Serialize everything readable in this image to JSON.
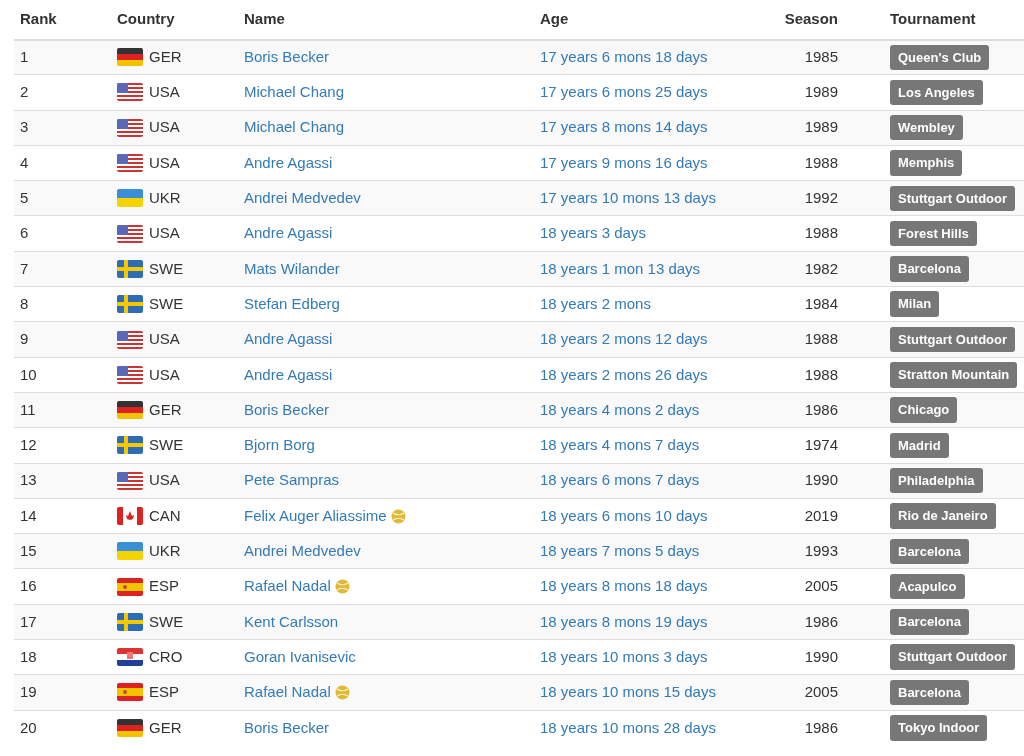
{
  "columns": [
    "Rank",
    "Country",
    "Name",
    "Age",
    "Season",
    "Tournament"
  ],
  "rows": [
    {
      "rank": "1",
      "flag": {
        "kind": "germany"
      },
      "country": "GER",
      "name": "Boris Becker",
      "ball": false,
      "age": "17 years 6 mons 18 days",
      "season": "1985",
      "tournament": "Queen's Club"
    },
    {
      "rank": "2",
      "flag": {
        "kind": "usa"
      },
      "country": "USA",
      "name": "Michael Chang",
      "ball": false,
      "age": "17 years 6 mons 25 days",
      "season": "1989",
      "tournament": "Los Angeles"
    },
    {
      "rank": "3",
      "flag": {
        "kind": "usa"
      },
      "country": "USA",
      "name": "Michael Chang",
      "ball": false,
      "age": "17 years 8 mons 14 days",
      "season": "1989",
      "tournament": "Wembley"
    },
    {
      "rank": "4",
      "flag": {
        "kind": "usa"
      },
      "country": "USA",
      "name": "Andre Agassi",
      "ball": false,
      "age": "17 years 9 mons 16 days",
      "season": "1988",
      "tournament": "Memphis"
    },
    {
      "rank": "5",
      "flag": {
        "kind": "ukraine"
      },
      "country": "UKR",
      "name": "Andrei Medvedev",
      "ball": false,
      "age": "17 years 10 mons 13 days",
      "season": "1992",
      "tournament": "Stuttgart Outdoor"
    },
    {
      "rank": "6",
      "flag": {
        "kind": "usa"
      },
      "country": "USA",
      "name": "Andre Agassi",
      "ball": false,
      "age": "18 years 3 days",
      "season": "1988",
      "tournament": "Forest Hills"
    },
    {
      "rank": "7",
      "flag": {
        "kind": "sweden"
      },
      "country": "SWE",
      "name": "Mats Wilander",
      "ball": false,
      "age": "18 years 1 mon 13 days",
      "season": "1982",
      "tournament": "Barcelona"
    },
    {
      "rank": "8",
      "flag": {
        "kind": "sweden"
      },
      "country": "SWE",
      "name": "Stefan Edberg",
      "ball": false,
      "age": "18 years 2 mons",
      "season": "1984",
      "tournament": "Milan"
    },
    {
      "rank": "9",
      "flag": {
        "kind": "usa"
      },
      "country": "USA",
      "name": "Andre Agassi",
      "ball": false,
      "age": "18 years 2 mons 12 days",
      "season": "1988",
      "tournament": "Stuttgart Outdoor"
    },
    {
      "rank": "10",
      "flag": {
        "kind": "usa"
      },
      "country": "USA",
      "name": "Andre Agassi",
      "ball": false,
      "age": "18 years 2 mons 26 days",
      "season": "1988",
      "tournament": "Stratton Mountain"
    },
    {
      "rank": "11",
      "flag": {
        "kind": "germany"
      },
      "country": "GER",
      "name": "Boris Becker",
      "ball": false,
      "age": "18 years 4 mons 2 days",
      "season": "1986",
      "tournament": "Chicago"
    },
    {
      "rank": "12",
      "flag": {
        "kind": "sweden"
      },
      "country": "SWE",
      "name": "Bjorn Borg",
      "ball": false,
      "age": "18 years 4 mons 7 days",
      "season": "1974",
      "tournament": "Madrid"
    },
    {
      "rank": "13",
      "flag": {
        "kind": "usa"
      },
      "country": "USA",
      "name": "Pete Sampras",
      "ball": false,
      "age": "18 years 6 mons 7 days",
      "season": "1990",
      "tournament": "Philadelphia"
    },
    {
      "rank": "14",
      "flag": {
        "kind": "canada"
      },
      "country": "CAN",
      "name": "Felix Auger Aliassime",
      "ball": true,
      "age": "18 years 6 mons 10 days",
      "season": "2019",
      "tournament": "Rio de Janeiro"
    },
    {
      "rank": "15",
      "flag": {
        "kind": "ukraine"
      },
      "country": "UKR",
      "name": "Andrei Medvedev",
      "ball": false,
      "age": "18 years 7 mons 5 days",
      "season": "1993",
      "tournament": "Barcelona"
    },
    {
      "rank": "16",
      "flag": {
        "kind": "spain"
      },
      "country": "ESP",
      "name": "Rafael Nadal",
      "ball": true,
      "age": "18 years 8 mons 18 days",
      "season": "2005",
      "tournament": "Acapulco"
    },
    {
      "rank": "17",
      "flag": {
        "kind": "sweden"
      },
      "country": "SWE",
      "name": "Kent Carlsson",
      "ball": false,
      "age": "18 years 8 mons 19 days",
      "season": "1986",
      "tournament": "Barcelona"
    },
    {
      "rank": "18",
      "flag": {
        "kind": "croatia"
      },
      "country": "CRO",
      "name": "Goran Ivanisevic",
      "ball": false,
      "age": "18 years 10 mons 3 days",
      "season": "1990",
      "tournament": "Stuttgart Outdoor"
    },
    {
      "rank": "19",
      "flag": {
        "kind": "spain"
      },
      "country": "ESP",
      "name": "Rafael Nadal",
      "ball": true,
      "age": "18 years 10 mons 15 days",
      "season": "2005",
      "tournament": "Barcelona"
    },
    {
      "rank": "20",
      "flag": {
        "kind": "germany"
      },
      "country": "GER",
      "name": "Boris Becker",
      "ball": false,
      "age": "18 years 10 mons 28 days",
      "season": "1986",
      "tournament": "Tokyo Indoor"
    }
  ]
}
